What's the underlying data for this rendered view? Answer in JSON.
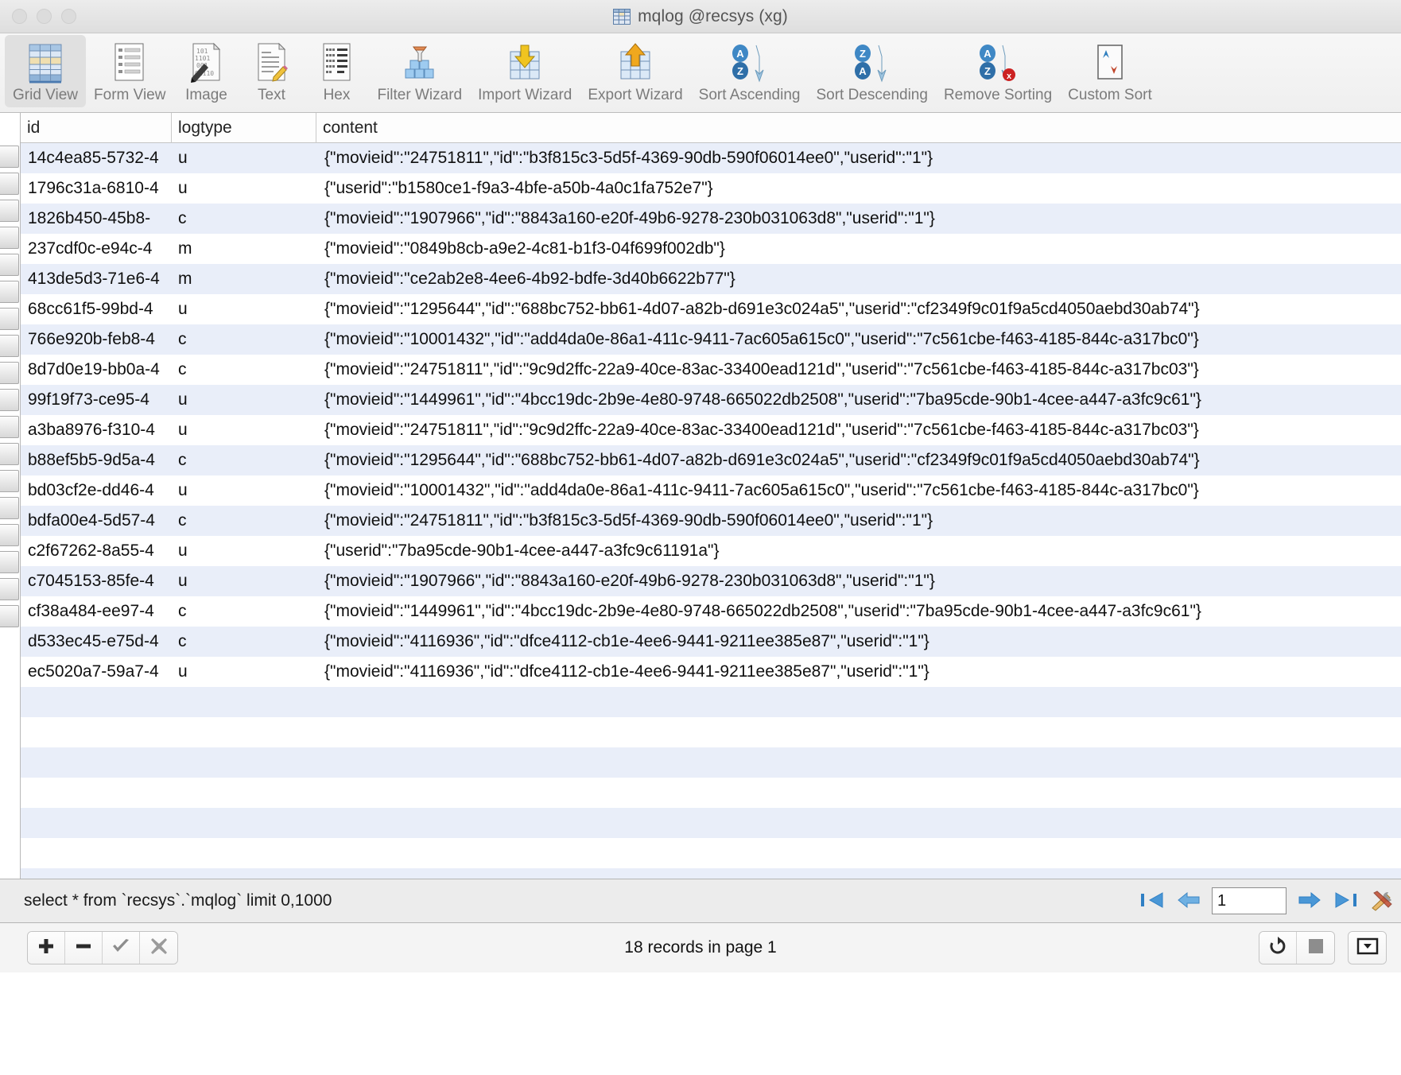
{
  "window": {
    "title": "mqlog @recsys (xg)",
    "title_icon": "table-icon",
    "traffic_lights": [
      "close-button",
      "minimize-button",
      "zoom-button"
    ]
  },
  "toolbar": {
    "items": [
      {
        "label": "Grid View",
        "icon": "grid-view-icon",
        "active": true
      },
      {
        "label": "Form View",
        "icon": "form-view-icon",
        "active": false
      },
      {
        "label": "Image",
        "icon": "image-icon",
        "active": false
      },
      {
        "label": "Text",
        "icon": "text-icon",
        "active": false
      },
      {
        "label": "Hex",
        "icon": "hex-icon",
        "active": false
      },
      {
        "label": "Filter Wizard",
        "icon": "filter-wizard-icon",
        "active": false
      },
      {
        "label": "Import Wizard",
        "icon": "import-wizard-icon",
        "active": false
      },
      {
        "label": "Export Wizard",
        "icon": "export-wizard-icon",
        "active": false
      },
      {
        "label": "Sort Ascending",
        "icon": "sort-ascending-icon",
        "active": false
      },
      {
        "label": "Sort Descending",
        "icon": "sort-descending-icon",
        "active": false
      },
      {
        "label": "Remove Sorting",
        "icon": "remove-sorting-icon",
        "active": false
      },
      {
        "label": "Custom Sort",
        "icon": "custom-sort-icon",
        "active": false
      }
    ]
  },
  "grid": {
    "columns": [
      "id",
      "logtype",
      "content"
    ],
    "rows": [
      {
        "id": "14c4ea85-5732-4",
        "logtype": "u",
        "content": "{\"movieid\":\"24751811\",\"id\":\"b3f815c3-5d5f-4369-90db-590f06014ee0\",\"userid\":\"1\"}"
      },
      {
        "id": "1796c31a-6810-4",
        "logtype": "u",
        "content": "{\"userid\":\"b1580ce1-f9a3-4bfe-a50b-4a0c1fa752e7\"}"
      },
      {
        "id": "1826b450-45b8-",
        "logtype": "c",
        "content": "{\"movieid\":\"1907966\",\"id\":\"8843a160-e20f-49b6-9278-230b031063d8\",\"userid\":\"1\"}"
      },
      {
        "id": "237cdf0c-e94c-4",
        "logtype": "m",
        "content": "{\"movieid\":\"0849b8cb-a9e2-4c81-b1f3-04f699f002db\"}"
      },
      {
        "id": "413de5d3-71e6-4",
        "logtype": "m",
        "content": "{\"movieid\":\"ce2ab2e8-4ee6-4b92-bdfe-3d40b6622b77\"}"
      },
      {
        "id": "68cc61f5-99bd-4",
        "logtype": "u",
        "content": "{\"movieid\":\"1295644\",\"id\":\"688bc752-bb61-4d07-a82b-d691e3c024a5\",\"userid\":\"cf2349f9c01f9a5cd4050aebd30ab74\"}"
      },
      {
        "id": "766e920b-feb8-4",
        "logtype": "c",
        "content": "{\"movieid\":\"10001432\",\"id\":\"add4da0e-86a1-411c-9411-7ac605a615c0\",\"userid\":\"7c561cbe-f463-4185-844c-a317bc0\"}"
      },
      {
        "id": "8d7d0e19-bb0a-4",
        "logtype": "c",
        "content": "{\"movieid\":\"24751811\",\"id\":\"9c9d2ffc-22a9-40ce-83ac-33400ead121d\",\"userid\":\"7c561cbe-f463-4185-844c-a317bc03\"}"
      },
      {
        "id": "99f19f73-ce95-4",
        "logtype": "u",
        "content": "{\"movieid\":\"1449961\",\"id\":\"4bcc19dc-2b9e-4e80-9748-665022db2508\",\"userid\":\"7ba95cde-90b1-4cee-a447-a3fc9c61\"}"
      },
      {
        "id": "a3ba8976-f310-4",
        "logtype": "u",
        "content": "{\"movieid\":\"24751811\",\"id\":\"9c9d2ffc-22a9-40ce-83ac-33400ead121d\",\"userid\":\"7c561cbe-f463-4185-844c-a317bc03\"}"
      },
      {
        "id": "b88ef5b5-9d5a-4",
        "logtype": "c",
        "content": "{\"movieid\":\"1295644\",\"id\":\"688bc752-bb61-4d07-a82b-d691e3c024a5\",\"userid\":\"cf2349f9c01f9a5cd4050aebd30ab74\"}"
      },
      {
        "id": "bd03cf2e-dd46-4",
        "logtype": "u",
        "content": "{\"movieid\":\"10001432\",\"id\":\"add4da0e-86a1-411c-9411-7ac605a615c0\",\"userid\":\"7c561cbe-f463-4185-844c-a317bc0\"}"
      },
      {
        "id": "bdfa00e4-5d57-4",
        "logtype": "c",
        "content": "{\"movieid\":\"24751811\",\"id\":\"b3f815c3-5d5f-4369-90db-590f06014ee0\",\"userid\":\"1\"}"
      },
      {
        "id": "c2f67262-8a55-4",
        "logtype": "u",
        "content": "{\"userid\":\"7ba95cde-90b1-4cee-a447-a3fc9c61191a\"}"
      },
      {
        "id": "c7045153-85fe-4",
        "logtype": "u",
        "content": "{\"movieid\":\"1907966\",\"id\":\"8843a160-e20f-49b6-9278-230b031063d8\",\"userid\":\"1\"}"
      },
      {
        "id": "cf38a484-ee97-4",
        "logtype": "c",
        "content": "{\"movieid\":\"1449961\",\"id\":\"4bcc19dc-2b9e-4e80-9748-665022db2508\",\"userid\":\"7ba95cde-90b1-4cee-a447-a3fc9c61\"}"
      },
      {
        "id": "d533ec45-e75d-4",
        "logtype": "c",
        "content": "{\"movieid\":\"4116936\",\"id\":\"dfce4112-cb1e-4ee6-9441-9211ee385e87\",\"userid\":\"1\"}"
      },
      {
        "id": "ec5020a7-59a7-4",
        "logtype": "u",
        "content": "{\"movieid\":\"4116936\",\"id\":\"dfce4112-cb1e-4ee6-9441-9211ee385e87\",\"userid\":\"1\"}"
      }
    ]
  },
  "querybar": {
    "query": "select * from `recsys`.`mqlog`  limit 0,1000",
    "page_value": "1",
    "page_placeholder": "1",
    "buttons": [
      {
        "name": "first-page-button",
        "icon": "first-page-icon"
      },
      {
        "name": "previous-page-button",
        "icon": "previous-page-icon"
      },
      {
        "name": "next-page-button",
        "icon": "next-page-icon"
      },
      {
        "name": "last-page-button",
        "icon": "last-page-icon"
      },
      {
        "name": "query-tools-button",
        "icon": "tools-icon"
      }
    ]
  },
  "statusbar": {
    "record_count": "18 records in page 1",
    "edit_buttons": [
      {
        "name": "add-record-button",
        "icon": "plus-icon"
      },
      {
        "name": "delete-record-button",
        "icon": "minus-icon"
      },
      {
        "name": "apply-changes-button",
        "icon": "check-icon"
      },
      {
        "name": "discard-changes-button",
        "icon": "cross-icon"
      }
    ],
    "right_buttons": [
      {
        "name": "refresh-button",
        "icon": "refresh-icon"
      },
      {
        "name": "stop-button",
        "icon": "stop-icon"
      },
      {
        "name": "options-button",
        "icon": "dropdown-icon"
      }
    ]
  },
  "colors": {
    "row_alt": "#e9eef9",
    "accent_blue": "#3b8fd4",
    "toolbar_label": "#7b7b7b"
  }
}
